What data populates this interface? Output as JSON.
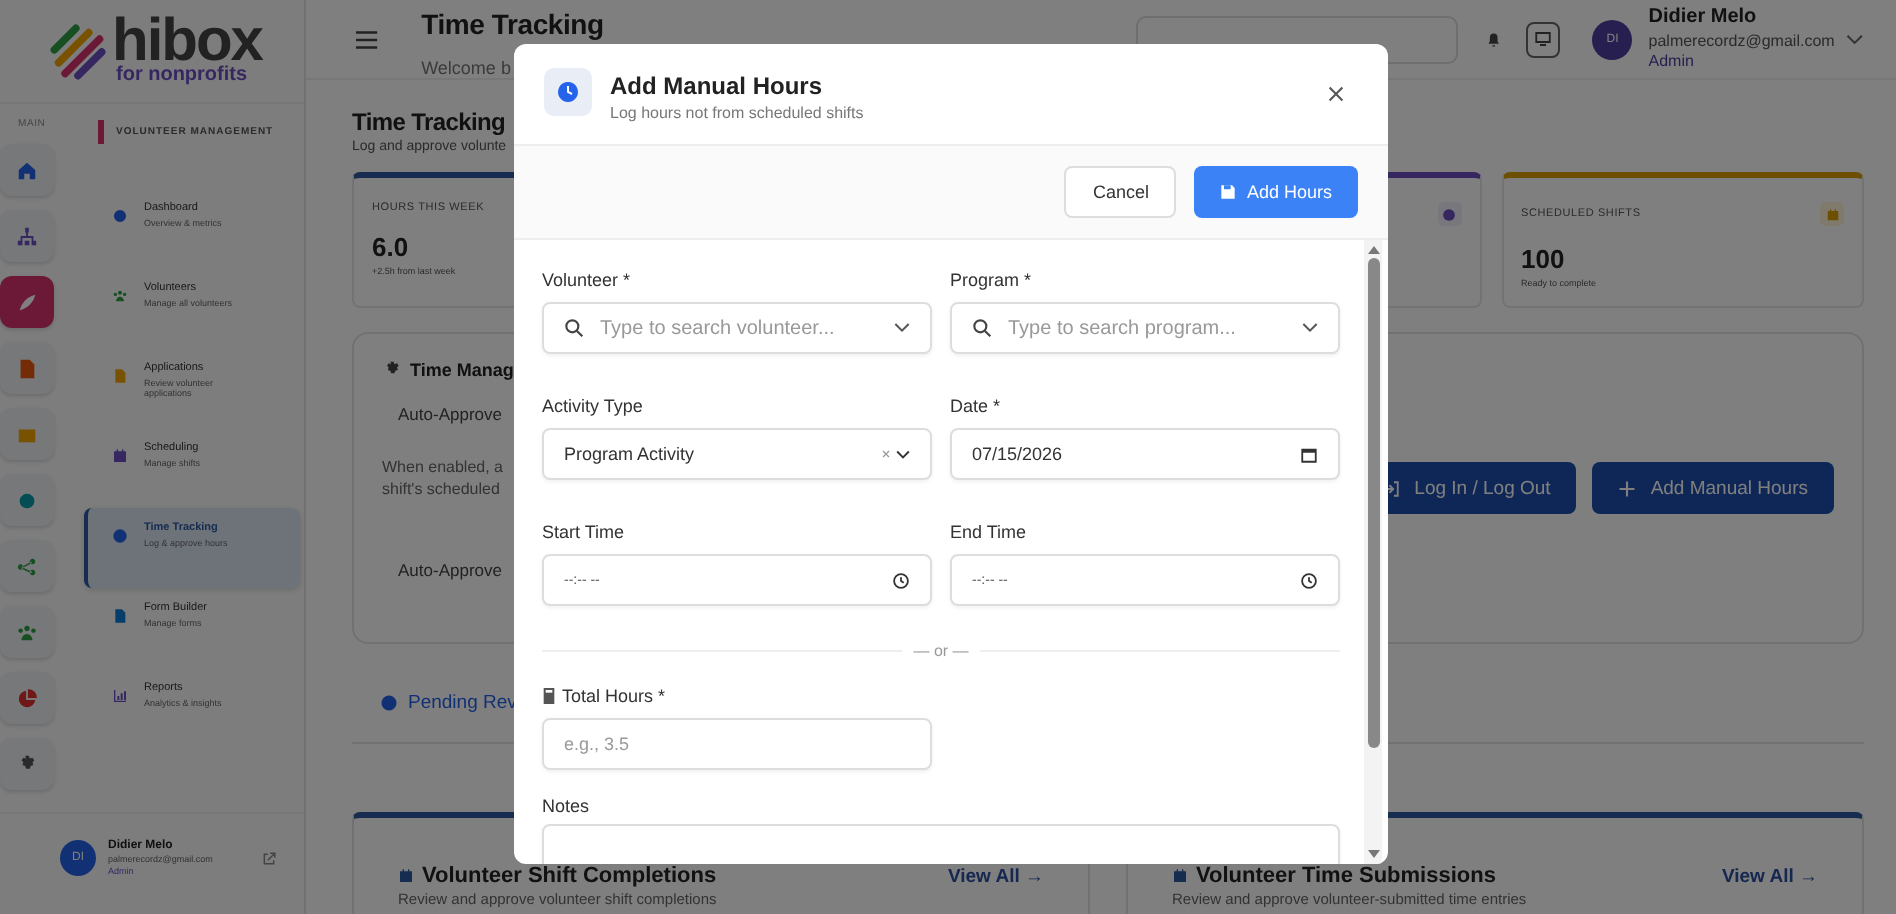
{
  "logo": {
    "name": "hibox",
    "tagline": "for nonprofits"
  },
  "rail": {
    "label": "MAIN",
    "items": [
      {
        "selected": false
      },
      {
        "selected": false
      },
      {
        "selected": true
      },
      {
        "selected": false
      },
      {
        "selected": false
      },
      {
        "selected": false
      },
      {
        "selected": false
      },
      {
        "selected": false
      },
      {
        "selected": false
      },
      {
        "selected": false
      }
    ]
  },
  "nav": {
    "section": "VOLUNTEER MANAGEMENT",
    "items": [
      {
        "title": "Dashboard",
        "subtitle": "Overview & metrics",
        "selected": false
      },
      {
        "title": "Volunteers",
        "subtitle": "Manage all volunteers",
        "selected": false
      },
      {
        "title": "Applications",
        "subtitle": "Review volunteer applications",
        "selected": false
      },
      {
        "title": "Scheduling",
        "subtitle": "Manage shifts",
        "selected": false
      },
      {
        "title": "Time Tracking",
        "subtitle": "Log & approve hours",
        "selected": true
      },
      {
        "title": "Form Builder",
        "subtitle": "Manage forms",
        "selected": false
      },
      {
        "title": "Reports",
        "subtitle": "Analytics & insights",
        "selected": false
      }
    ]
  },
  "sidebar_user": {
    "initials": "DI",
    "name": "Didier Melo",
    "email": "palmerecordz@gmail.com",
    "role": "Admin"
  },
  "header": {
    "title": "Time Tracking",
    "subtitle": "Welcome b",
    "user": {
      "initials": "DI",
      "name": "Didier Melo",
      "email": "palmerecordz@gmail.com",
      "role": "Admin"
    }
  },
  "page": {
    "title": "Time Tracking",
    "subtitle": "Log and approve volunte"
  },
  "stats": [
    {
      "kind": "full",
      "label": "HOURS THIS WEEK",
      "value": "6.0",
      "note": "+2.5h from last week"
    },
    {
      "kind": "icon_only"
    },
    {
      "kind": "full",
      "label": "SCHEDULED SHIFTS",
      "value": "100",
      "note": "Ready to complete"
    }
  ],
  "time_management": {
    "title": "Time Manag",
    "setting_1": "Auto-Approve",
    "description": [
      "When enabled, a",
      "shift's scheduled"
    ],
    "setting_2": "Auto-Approve",
    "buttons": [
      {
        "kind": "login",
        "label": "Log In / Log Out"
      },
      {
        "kind": "add",
        "label": "Add Manual Hours"
      }
    ]
  },
  "tab": {
    "label": "Pending Rev"
  },
  "cards": [
    {
      "title": "Volunteer Shift Completions",
      "subtitle": "Review and approve volunteer shift completions",
      "link": "View All →"
    },
    {
      "title": "Volunteer Time Submissions",
      "subtitle": "Review and approve volunteer-submitted time entries",
      "link": "View All →"
    }
  ],
  "modal": {
    "title": "Add Manual Hours",
    "subtitle": "Log hours not from scheduled shifts",
    "buttons": [
      {
        "kind": "secondary",
        "label": "Cancel"
      },
      {
        "kind": "primary",
        "label": "Add Hours"
      }
    ],
    "fields": [
      {
        "kind": "search",
        "label": "Volunteer *",
        "placeholder": "Type to search volunteer..."
      },
      {
        "kind": "search",
        "label": "Program *",
        "placeholder": "Type to search program..."
      },
      {
        "kind": "select",
        "label": "Activity Type",
        "value": "Program Activity"
      },
      {
        "kind": "date",
        "label": "Date *",
        "value": "07/15/2026"
      },
      {
        "kind": "time",
        "label": "Start Time",
        "placeholder": "--:-- --"
      },
      {
        "kind": "time",
        "label": "End Time",
        "placeholder": "--:-- --"
      },
      {
        "kind": "divider",
        "label": "— or —"
      },
      {
        "kind": "number",
        "label": "Total Hours *",
        "placeholder": "e.g., 3.5"
      },
      {
        "kind": "textarea",
        "label": "Notes"
      }
    ]
  }
}
